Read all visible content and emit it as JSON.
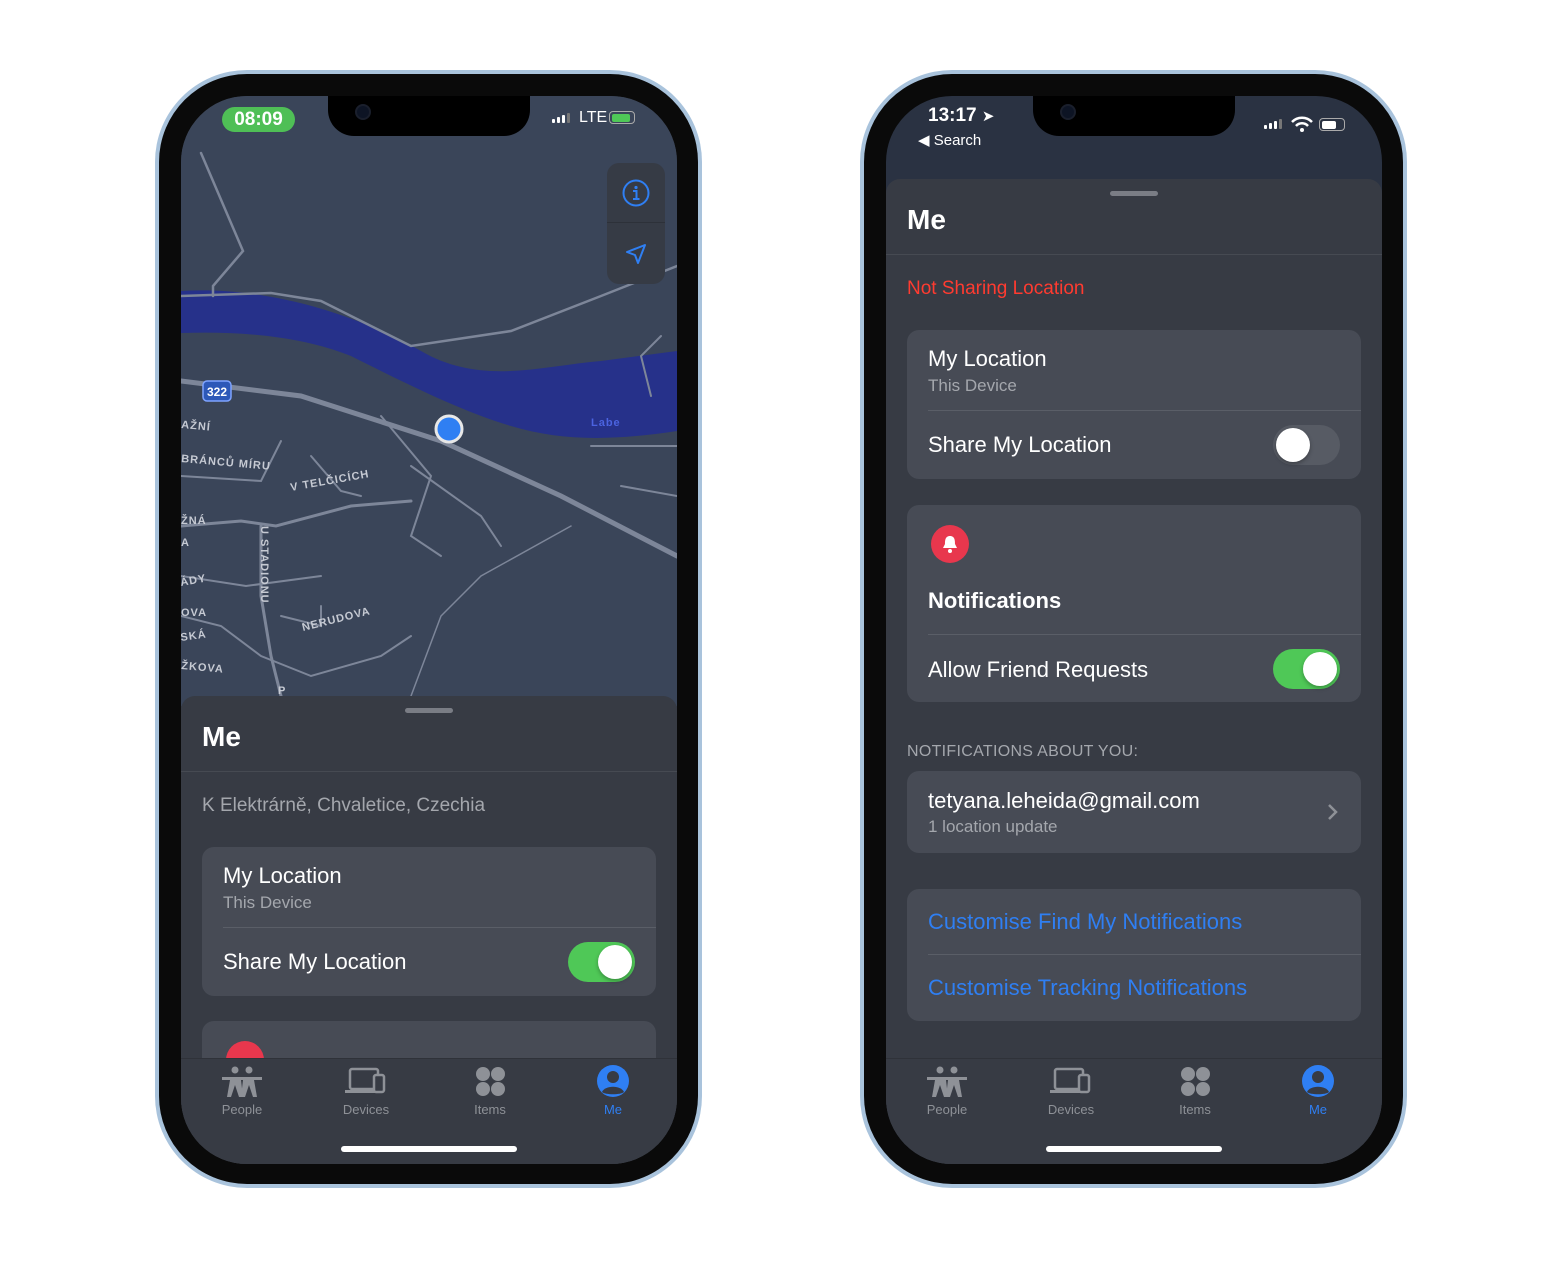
{
  "left_phone": {
    "status": {
      "time": "08:09",
      "network": "LTE",
      "battery_charging": true
    },
    "map": {
      "route_badge": "322",
      "river_label": "Labe",
      "street_labels": [
        "V TELČICÍCH",
        "U STADIONU",
        "NERUDOVA",
        "BRÁNCŮ MÍRU",
        "AŽNÍ",
        "ŽNÁ",
        "A",
        "ÁDY",
        "OVA",
        "SKÁ",
        "ŽKOVA",
        "P"
      ],
      "buttons": [
        {
          "icon": "info-icon"
        },
        {
          "icon": "location-arrow-icon"
        }
      ],
      "colors": {
        "land": "#3a4559",
        "water": "#26318a",
        "roads": "#7d8699",
        "user_dot": "#2f7ff3"
      }
    },
    "sheet": {
      "title": "Me",
      "address": "K Elektrárně, Chvaletice, Czechia",
      "location_card": {
        "title": "My Location",
        "subtitle": "This Device",
        "share_label": "Share My Location",
        "share_on": true
      }
    }
  },
  "right_phone": {
    "status": {
      "time": "13:17",
      "back_label": "Search"
    },
    "sheet": {
      "title": "Me",
      "sharing_status": "Not Sharing Location",
      "location_card": {
        "title": "My Location",
        "subtitle": "This Device",
        "share_label": "Share My Location",
        "share_on": false
      },
      "notifications_card": {
        "title": "Notifications",
        "allow_label": "Allow Friend Requests",
        "allow_on": true
      },
      "about_you_header": "NOTIFICATIONS ABOUT YOU:",
      "about_you_item": {
        "email": "tetyana.leheida@gmail.com",
        "detail": "1 location update"
      },
      "links": [
        "Customise Find My Notifications",
        "Customise Tracking Notifications"
      ]
    }
  },
  "tabs": [
    {
      "label": "People",
      "icon": "people-icon"
    },
    {
      "label": "Devices",
      "icon": "devices-icon"
    },
    {
      "label": "Items",
      "icon": "items-icon"
    },
    {
      "label": "Me",
      "icon": "me-icon",
      "active": true
    }
  ],
  "colors": {
    "accent": "#2f7ff3",
    "toggle_on": "#4fc857",
    "alert_red": "#e8374d",
    "warning_text": "#ff3b30"
  }
}
